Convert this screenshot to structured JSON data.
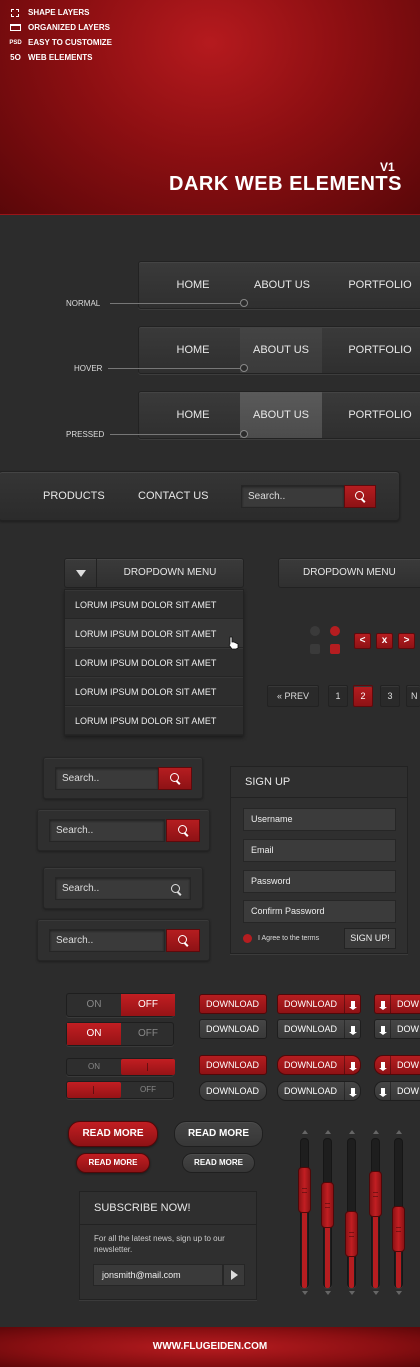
{
  "header": {
    "features": [
      {
        "icon": "shape-layers-icon",
        "label": "SHAPE LAYERS"
      },
      {
        "icon": "folder-icon",
        "label": "ORGANIZED LAYERS"
      },
      {
        "icon": "psd-icon",
        "icon_text": "PSD",
        "label": "EASY TO CUSTOMIZE"
      },
      {
        "icon": "web-icon",
        "icon_text": "5O",
        "label": "WEB ELEMENTS"
      }
    ],
    "title": "DARK WEB ELEMENTS",
    "version": "V1"
  },
  "nav_states": {
    "items": [
      "HOME",
      "ABOUT US",
      "PORTFOLIO"
    ],
    "normal_label": "NORMAL",
    "hover_label": "HOVER",
    "pressed_label": "PRESSED"
  },
  "navbar2": {
    "items": [
      "PRODUCTS",
      "CONTACT US"
    ],
    "search_placeholder": "Search.."
  },
  "dropdown": {
    "title": "DROPDOWN MENU",
    "title2": "DROPDOWN MENU",
    "items": [
      "LORUM IPSUM DOLOR SIT AMET",
      "LORUM IPSUM DOLOR SIT AMET",
      "LORUM IPSUM DOLOR SIT AMET",
      "LORUM IPSUM DOLOR SIT AMET",
      "LORUM IPSUM DOLOR SIT AMET"
    ]
  },
  "arrows": {
    "prev": "<",
    "close": "x",
    "next": ">"
  },
  "pagination": {
    "prev": "« PREV",
    "pages": [
      "1",
      "2",
      "3",
      "N"
    ],
    "active_page": "2"
  },
  "search_widgets": {
    "placeholder": "Search.."
  },
  "signup": {
    "title": "SIGN UP",
    "fields": [
      "Username",
      "Email",
      "Password",
      "Confirm Password"
    ],
    "agree": "I Agree to the terms",
    "button": "SIGN UP!"
  },
  "toggles": {
    "on": "ON",
    "off": "OFF"
  },
  "download": {
    "label": "DOWNLOAD",
    "partial_label": "DOW"
  },
  "read_more": {
    "label": "READ MORE"
  },
  "sliders": {
    "levels": [
      0.72,
      0.58,
      0.3,
      0.68,
      0.35
    ]
  },
  "subscribe": {
    "title": "SUBSCRIBE NOW!",
    "text": "For all the latest news, sign up to our newsletter.",
    "email": "jonsmith@mail.com"
  },
  "footer": {
    "site": "WWW.FLUGEIDEN.COM"
  },
  "colors": {
    "accent": "#b51d20",
    "background": "#2c2c2c",
    "header": "#8d0f12"
  }
}
